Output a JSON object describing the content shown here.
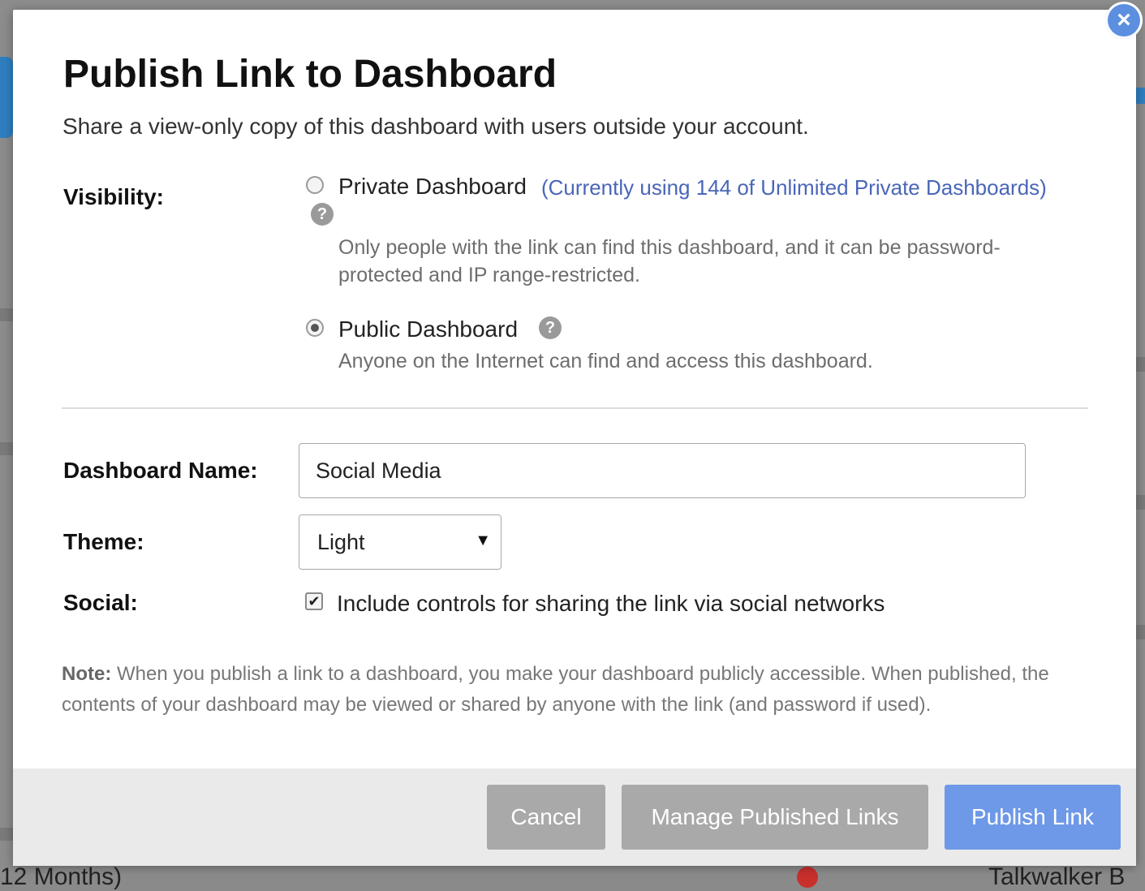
{
  "background": {
    "bottom_left_fragment": "12 Months)",
    "bottom_right_fragment": "Talkwalker B"
  },
  "modal": {
    "title": "Publish Link to Dashboard",
    "subtitle": "Share a view-only copy of this dashboard with users outside your account.",
    "visibility": {
      "label": "Visibility:",
      "options": [
        {
          "label": "Private Dashboard",
          "note": "(Currently using 144 of Unlimited Private Dashboards)",
          "description_line1": "Only people with the link can find this dashboard, and it can be password-",
          "description_line2": "protected and IP range-restricted.",
          "selected": false
        },
        {
          "label": "Public Dashboard",
          "description_line1": "Anyone on the Internet can find and access this dashboard.",
          "selected": true
        }
      ]
    },
    "dashboard_name": {
      "label": "Dashboard Name:",
      "value": "Social Media"
    },
    "theme": {
      "label": "Theme:",
      "selected": "Light"
    },
    "social": {
      "label": "Social:",
      "checkbox_label": "Include controls for sharing the link via social networks",
      "checked": true
    },
    "note": {
      "prefix": "Note:",
      "text": " When you publish a link to a dashboard, you make your dashboard publicly accessible. When published, the contents of your dashboard may be viewed or shared by anyone with the link (and password if used)."
    },
    "buttons": {
      "cancel": "Cancel",
      "manage": "Manage Published Links",
      "publish": "Publish Link"
    },
    "close_icon": "close-icon",
    "help_icon": "question-circle-icon"
  },
  "colors": {
    "primary_button": "#6e98e8",
    "secondary_button": "#a9a9a9",
    "note_link": "#4a66b8",
    "close_button": "#5c8fe0"
  }
}
